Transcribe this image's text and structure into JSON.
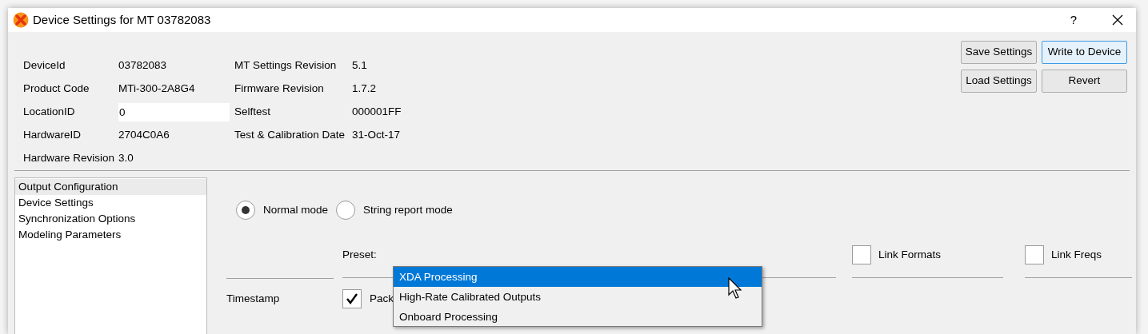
{
  "window": {
    "title": "Device Settings for MT 03782083",
    "help": "?"
  },
  "info_left": [
    {
      "label": "DeviceId",
      "value": "03782083",
      "kind": "text"
    },
    {
      "label": "Product Code",
      "value": "MTi-300-2A8G4",
      "kind": "text"
    },
    {
      "label": "LocationID",
      "value": "0",
      "kind": "field"
    },
    {
      "label": "HardwareID",
      "value": "2704C0A6",
      "kind": "text"
    },
    {
      "label": "Hardware Revision",
      "value": "3.0",
      "kind": "text"
    }
  ],
  "info_right": [
    {
      "label": "MT Settings Revision",
      "value": "5.1"
    },
    {
      "label": "Firmware Revision",
      "value": "1.7.2"
    },
    {
      "label": "Selftest",
      "value": "000001FF"
    },
    {
      "label": "Test & Calibration Date",
      "value": "31-Oct-17"
    }
  ],
  "buttons": [
    {
      "label": "Save Settings",
      "focused": false
    },
    {
      "label": "Write to Device",
      "focused": true
    },
    {
      "label": "Load Settings",
      "focused": false
    },
    {
      "label": "Revert",
      "focused": false
    }
  ],
  "sidebar": {
    "items": [
      {
        "label": "Output Configuration",
        "selected": true
      },
      {
        "label": "Device Settings",
        "selected": false
      },
      {
        "label": "Synchronization Options",
        "selected": false
      },
      {
        "label": "Modeling Parameters",
        "selected": false
      }
    ]
  },
  "modes": [
    {
      "label": "Normal mode",
      "selected": true
    },
    {
      "label": "String report mode",
      "selected": false
    }
  ],
  "preset": {
    "label": "Preset:",
    "options": [
      {
        "label": "XDA Processing",
        "selected": true
      },
      {
        "label": "High-Rate Calibrated Outputs",
        "selected": false
      },
      {
        "label": "Onboard Processing",
        "selected": false
      }
    ]
  },
  "links": [
    {
      "label": "Link Formats",
      "checked": false
    },
    {
      "label": "Link Freqs",
      "checked": false
    }
  ],
  "rows": [
    {
      "label": "Timestamp",
      "checkbox_label": "Pack",
      "checked": true
    }
  ]
}
